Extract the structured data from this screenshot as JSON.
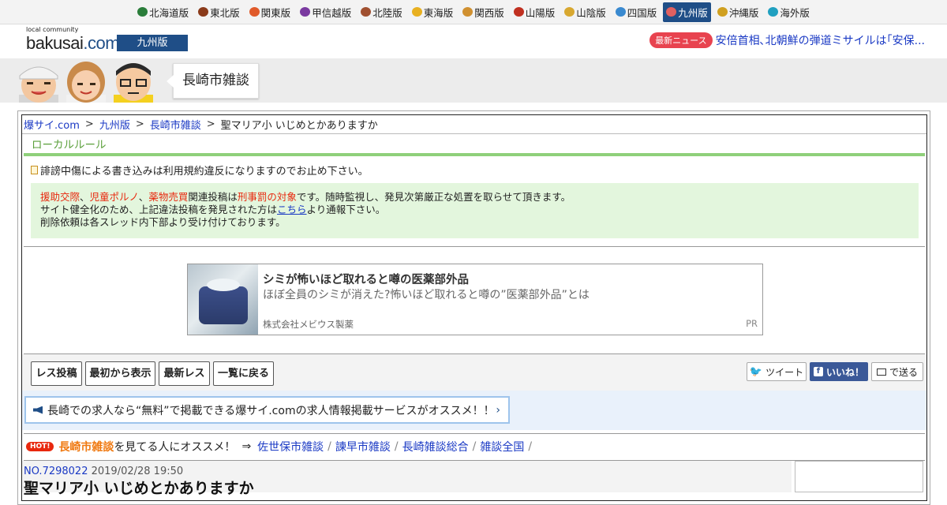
{
  "regions": [
    {
      "label": "北海道版",
      "color": "#2a7d3a",
      "icon": "hokkaido-icon"
    },
    {
      "label": "東北版",
      "color": "#8a3a1a",
      "icon": "tohoku-icon"
    },
    {
      "label": "関東版",
      "color": "#e05a2a",
      "icon": "tower-icon"
    },
    {
      "label": "甲信越版",
      "color": "#7a3aa0",
      "icon": "grape-icon"
    },
    {
      "label": "北陸版",
      "color": "#a05030",
      "icon": "gate-icon"
    },
    {
      "label": "東海版",
      "color": "#e8b020",
      "icon": "castle-icon"
    },
    {
      "label": "関西版",
      "color": "#d09030",
      "icon": "takoyaki-icon"
    },
    {
      "label": "山陽版",
      "color": "#c03020",
      "icon": "torii-icon"
    },
    {
      "label": "山陰版",
      "color": "#d8a830",
      "icon": "sandune-icon"
    },
    {
      "label": "四国版",
      "color": "#3a8ad0",
      "icon": "udon-icon"
    },
    {
      "label": "九州版",
      "color": "#e06060",
      "icon": "fish-icon",
      "active": true
    },
    {
      "label": "沖縄版",
      "color": "#d0a020",
      "icon": "shisa-icon"
    },
    {
      "label": "海外版",
      "color": "#20a0c0",
      "icon": "globe-icon"
    }
  ],
  "header": {
    "logo_small": "local community",
    "logo_main": "bakusai",
    "logo_tld": ".com",
    "edition": "九州版",
    "news_badge": "最新ニュース",
    "news_text": "安倍首相､北朝鮮の弾道ミサイルは｢安保..."
  },
  "banner": {
    "board_name": "長崎市雑談"
  },
  "breadcrumb": [
    {
      "label": "爆サイ.com"
    },
    {
      "label": "九州版"
    },
    {
      "label": "長崎市雑談"
    },
    {
      "label": "聖マリア小 いじめとかありますか",
      "current": true
    }
  ],
  "breadcrumb_sep": ">",
  "local_rule": "ローカルルール",
  "notice1": "誹謗中傷による書き込みは利用規約違反になりますのでお止め下さい。",
  "warning": {
    "term1": "援助交際",
    "comma1": "、",
    "term2": "児童ポルノ",
    "comma2": "、",
    "term3": "薬物売買",
    "mid": "関連投稿は",
    "term4": "刑事罰の対象",
    "tail": "です。随時監視し、発見次第厳正な処置を取らせて頂きます。",
    "line2_pre": "サイト健全化のため、上記違法投稿を発見された方は",
    "line2_link": "こちら",
    "line2_post": "より通報下さい。",
    "line3": "削除依頼は各スレッド内下部より受け付けております。"
  },
  "ad": {
    "title": "シミが怖いほど取れると噂の医薬部外品",
    "subtitle": "ほぼ全員のシミが消えた?怖いほど取れると噂の”医薬部外品”とは",
    "company": "株式会社メビウス製薬",
    "pr": "PR"
  },
  "actions": {
    "post": "レス投稿",
    "from_start": "最初から表示",
    "latest": "最新レス",
    "back": "一覧に戻る",
    "tweet": "ツイート",
    "like": "いいね！",
    "send": "で送る"
  },
  "jobs_text": "長崎での求人なら“無料”で掲載できる爆サイ.comの求人情報掲載サービスがオススメ！！",
  "recommend": {
    "hot": "HOT!",
    "board": "長崎市雑談",
    "text": "を見てる人にオススメ！",
    "arrow": "⇒",
    "links": [
      "佐世保市雑談",
      "諫早市雑談",
      "長崎雑談総合",
      "雑談全国"
    ],
    "slash": "/"
  },
  "post": {
    "number": "NO.7298022",
    "date": "2019/02/28 19:50",
    "title": "聖マリア小 いじめとかありますか"
  }
}
